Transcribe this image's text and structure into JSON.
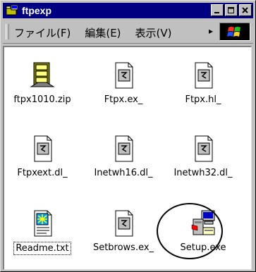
{
  "window": {
    "title": "ftpexp",
    "app_icon": "explorer-folder-icon",
    "controls": [
      "minimize",
      "maximize",
      "close"
    ]
  },
  "menubar": {
    "items": [
      {
        "label": "ファイル(F)",
        "icon": null
      },
      {
        "label": "編集(E)",
        "icon": null
      },
      {
        "label": "表示(V)",
        "icon": null
      }
    ],
    "overflow_icon": "chevron-right-icon",
    "throbber_icon": "windows-logo-icon"
  },
  "files": [
    {
      "name": "ftpx1010.zip",
      "icon": "zip-archive-icon"
    },
    {
      "name": "Ftpx.ex_",
      "icon": "generic-file-icon"
    },
    {
      "name": "Ftpx.hl_",
      "icon": "generic-file-icon"
    },
    {
      "name": "Ftpxext.dl_",
      "icon": "generic-file-icon"
    },
    {
      "name": "Inetwh16.dl_",
      "icon": "generic-file-icon"
    },
    {
      "name": "Inetwh32.dl_",
      "icon": "generic-file-icon"
    },
    {
      "name": "Readme.txt",
      "icon": "text-document-icon",
      "focused": true
    },
    {
      "name": "Setbrows.ex_",
      "icon": "generic-file-icon"
    },
    {
      "name": "Setup.exe",
      "icon": "setup-installer-icon",
      "circled": true
    }
  ],
  "colors": {
    "titlebar": "#000080",
    "chrome": "#c0c0c0",
    "content": "#ffffff"
  }
}
